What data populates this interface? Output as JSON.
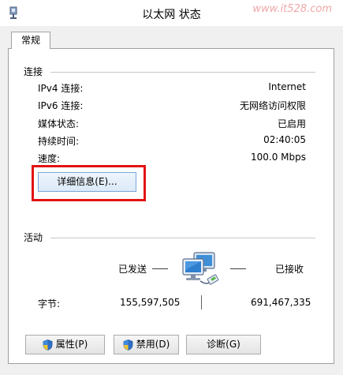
{
  "window": {
    "title": "以太网 状态",
    "watermark": "www.it528.com"
  },
  "tabs": [
    {
      "label": "常规"
    }
  ],
  "connection": {
    "heading": "连接",
    "rows": [
      {
        "label": "IPv4 连接:",
        "value": "Internet"
      },
      {
        "label": "IPv6 连接:",
        "value": "无网络访问权限"
      },
      {
        "label": "媒体状态:",
        "value": "已启用"
      },
      {
        "label": "持续时间:",
        "value": "02:40:05"
      },
      {
        "label": "速度:",
        "value": "100.0 Mbps"
      }
    ],
    "details_button": "详细信息(E)..."
  },
  "activity": {
    "heading": "活动",
    "sent_label": "已发送",
    "received_label": "已接收",
    "bytes_label": "字节:",
    "bytes_sent": "155,597,505",
    "bytes_received": "691,467,335",
    "icon": "network-computers-icon"
  },
  "buttons": {
    "properties": "属性(P)",
    "disable": "禁用(D)",
    "diagnose": "诊断(G)"
  },
  "colors": {
    "highlight": "#e21212",
    "watermark": "#f0a8a8"
  }
}
